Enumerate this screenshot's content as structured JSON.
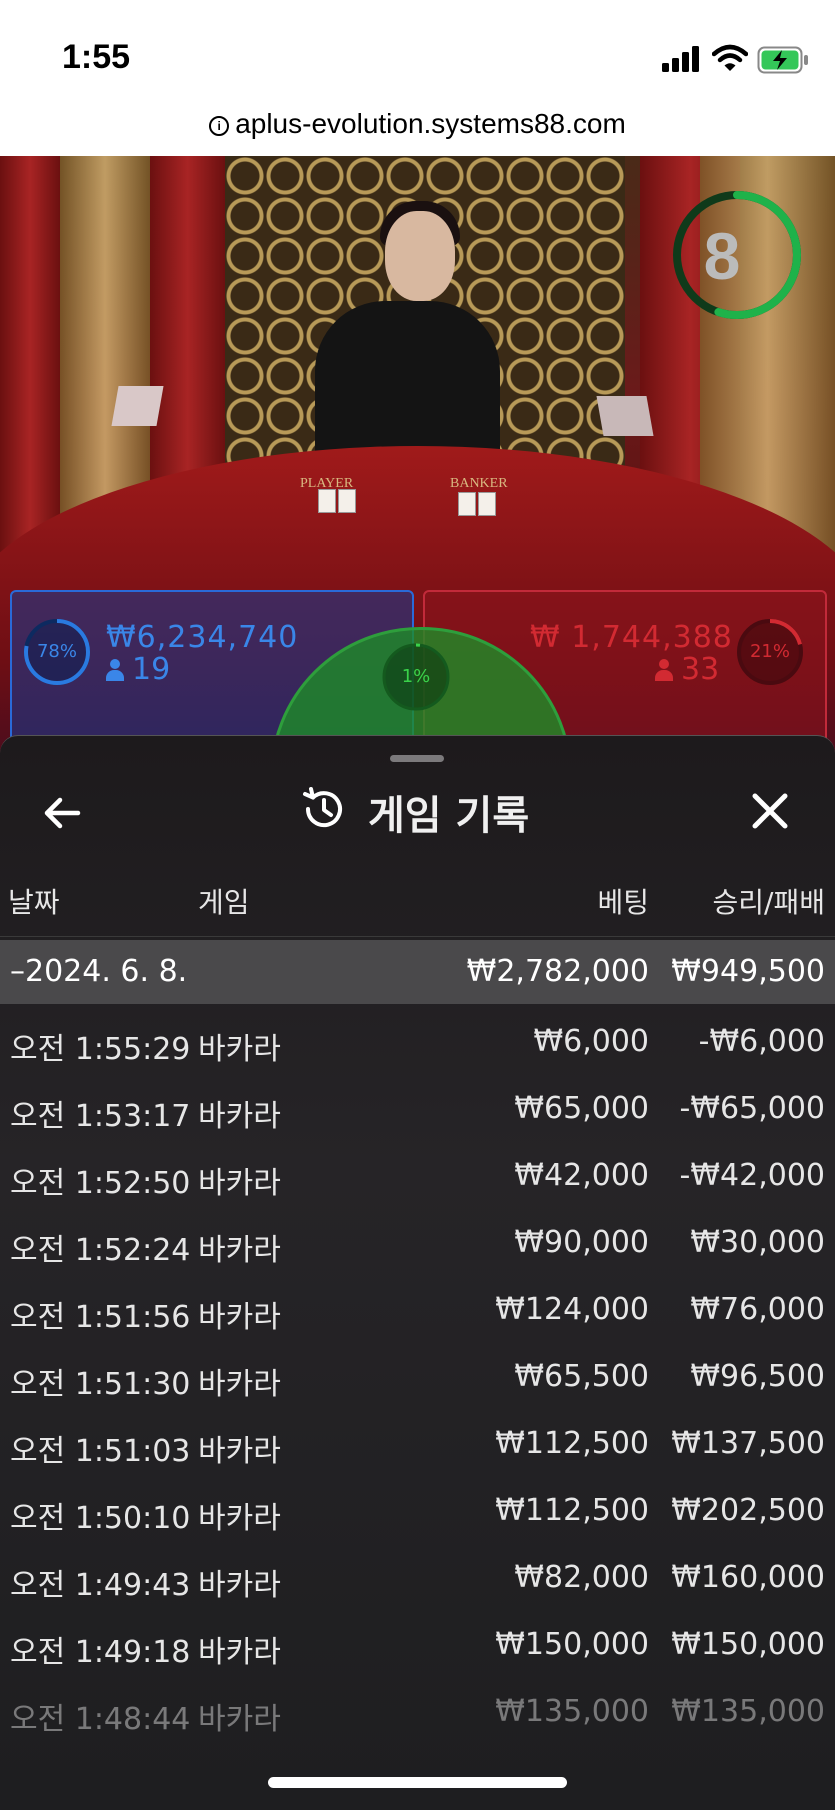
{
  "status": {
    "time": "1:55"
  },
  "browser": {
    "url": "aplus-evolution.systems88.com"
  },
  "game": {
    "countdown": "8",
    "table_labels": {
      "player": "PLAYER",
      "banker": "BANKER"
    },
    "player": {
      "percent": "78%",
      "amount": "₩6,234,740",
      "players": "19",
      "color": "#3a86e8"
    },
    "banker": {
      "percent": "21%",
      "amount": "₩ 1,744,388",
      "players": "33",
      "color": "#d22a32"
    },
    "tie": {
      "percent": "1%",
      "color": "#3ad24a"
    }
  },
  "history": {
    "title": "게임 기록",
    "columns": {
      "date": "날짜",
      "game": "게임",
      "bet": "베팅",
      "result": "승리/패배"
    },
    "summary": {
      "date": "–2024. 6. 8.",
      "bet": "₩2,782,000",
      "result": "₩949,500"
    },
    "rows": [
      {
        "time": "오전 1:55:29",
        "game": "바카라",
        "bet": "₩6,000",
        "result": "-₩6,000"
      },
      {
        "time": "오전 1:53:17",
        "game": "바카라",
        "bet": "₩65,000",
        "result": "-₩65,000"
      },
      {
        "time": "오전 1:52:50",
        "game": "바카라",
        "bet": "₩42,000",
        "result": "-₩42,000"
      },
      {
        "time": "오전 1:52:24",
        "game": "바카라",
        "bet": "₩90,000",
        "result": "₩30,000"
      },
      {
        "time": "오전 1:51:56",
        "game": "바카라",
        "bet": "₩124,000",
        "result": "₩76,000"
      },
      {
        "time": "오전 1:51:30",
        "game": "바카라",
        "bet": "₩65,500",
        "result": "₩96,500"
      },
      {
        "time": "오전 1:51:03",
        "game": "바카라",
        "bet": "₩112,500",
        "result": "₩137,500"
      },
      {
        "time": "오전 1:50:10",
        "game": "바카라",
        "bet": "₩112,500",
        "result": "₩202,500"
      },
      {
        "time": "오전 1:49:43",
        "game": "바카라",
        "bet": "₩82,000",
        "result": "₩160,000"
      },
      {
        "time": "오전 1:49:18",
        "game": "바카라",
        "bet": "₩150,000",
        "result": "₩150,000"
      },
      {
        "time": "오전 1:48:44",
        "game": "바카라",
        "bet": "₩135,000",
        "result": "₩135,000"
      }
    ]
  }
}
